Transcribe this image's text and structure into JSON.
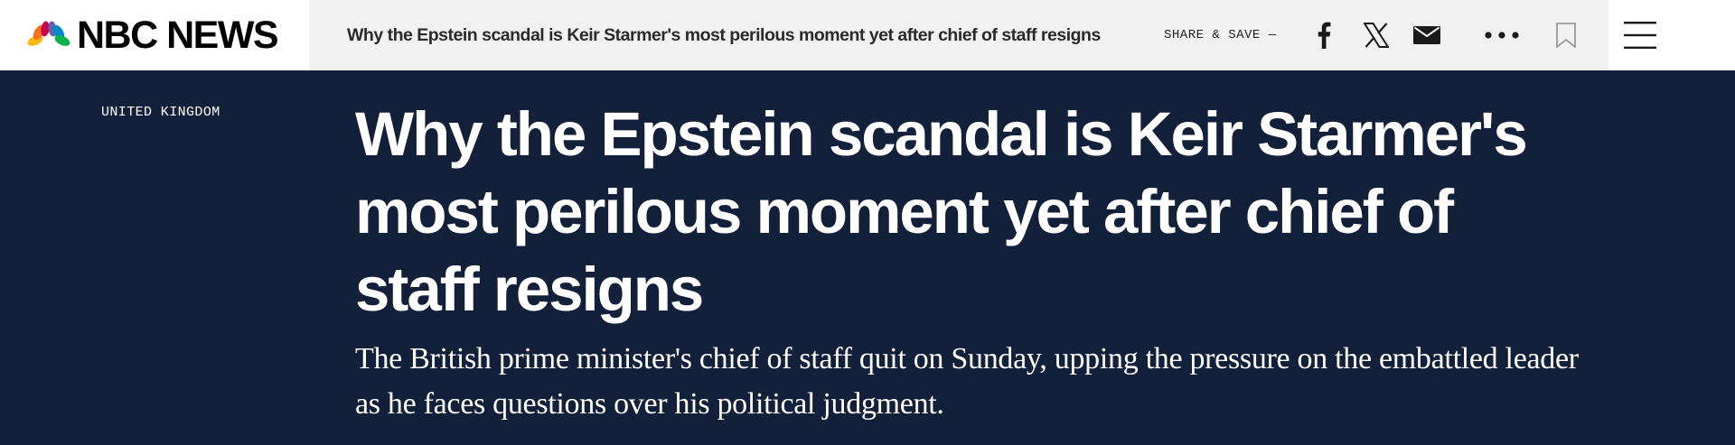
{
  "header": {
    "logo_text": "NBC NEWS",
    "sticky_headline": "Why the Epstein scandal is Keir Starmer's most perilous moment yet after chief of staff resigns",
    "share_label": "SHARE & SAVE —",
    "icons": [
      "facebook-icon",
      "x-icon",
      "email-icon",
      "more-icon",
      "bookmark-icon",
      "menu-icon"
    ]
  },
  "article": {
    "eyebrow": "UNITED KINGDOM",
    "headline": "Why the Epstein scandal is Keir Starmer's most perilous moment yet after chief of staff resigns",
    "dek": "The British prime minister's chief of staff quit on Sunday, upping the pressure on the embattled leader as he faces questions over his political judgment."
  },
  "colors": {
    "hero_background": "#13203a",
    "sticky_bar_background": "#f1f1f1",
    "peacock": [
      "#fcb711",
      "#f37021",
      "#cc004c",
      "#6460aa",
      "#0089d0",
      "#0db14b"
    ]
  }
}
